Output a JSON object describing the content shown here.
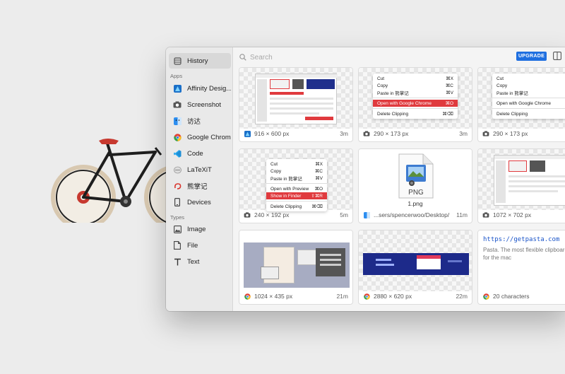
{
  "sidebar": {
    "history": "History",
    "apps_heading": "Apps",
    "apps": [
      {
        "label": "Affinity Desig...",
        "icon": "affinity-designer-icon"
      },
      {
        "label": "Screenshot",
        "icon": "camera-icon"
      },
      {
        "label": "访达",
        "icon": "finder-icon"
      },
      {
        "label": "Google Chrome",
        "icon": "chrome-icon"
      },
      {
        "label": "Code",
        "icon": "vscode-icon"
      },
      {
        "label": "LaTeXiT",
        "icon": "latexit-icon"
      },
      {
        "label": "熊掌记",
        "icon": "bear-icon"
      },
      {
        "label": "Devices",
        "icon": "device-icon"
      }
    ],
    "types_heading": "Types",
    "types": [
      {
        "label": "Image",
        "icon": "image-icon"
      },
      {
        "label": "File",
        "icon": "file-icon"
      },
      {
        "label": "Text",
        "icon": "text-icon"
      }
    ]
  },
  "toolbar": {
    "search_placeholder": "Search",
    "upgrade_label": "UPGRADE"
  },
  "menu_a": {
    "items": [
      {
        "label": "Cut",
        "shortcut": "⌘X"
      },
      {
        "label": "Copy",
        "shortcut": "⌘C"
      },
      {
        "label": "Paste in 熊掌记",
        "shortcut": "⌘V"
      },
      {
        "label": "Open with Google Chrome",
        "shortcut": "⌘O"
      },
      {
        "label": "Delete Clipping",
        "shortcut": "⌘⌫"
      }
    ]
  },
  "menu_b": {
    "items": [
      {
        "label": "Cut",
        "shortcut": "⌘X"
      },
      {
        "label": "Copy",
        "shortcut": "⌘C"
      },
      {
        "label": "Paste in 熊掌记",
        "shortcut": ""
      },
      {
        "label": "Open with Google Chrome",
        "shortcut": ""
      },
      {
        "label": "Delete Clipping",
        "shortcut": ""
      }
    ]
  },
  "menu_c": {
    "items": [
      {
        "label": "Cut",
        "shortcut": "⌘X"
      },
      {
        "label": "Copy",
        "shortcut": "⌘C"
      },
      {
        "label": "Paste in 熊掌记",
        "shortcut": "⌘V"
      },
      {
        "label": "Open with Preview",
        "shortcut": "⌘O"
      },
      {
        "label": "Show in Finder",
        "shortcut": "⇧⌘R"
      },
      {
        "label": "Delete Clipping",
        "shortcut": "⌘⌫"
      }
    ]
  },
  "clips": [
    {
      "desc": "916 × 600 px",
      "time": "3m",
      "source_icon": "affinity-designer-icon"
    },
    {
      "desc": "290 × 173 px",
      "time": "3m",
      "source_icon": "camera-icon"
    },
    {
      "desc": "290 × 173 px",
      "time": "",
      "source_icon": "camera-icon"
    },
    {
      "desc": "240 × 192 px",
      "time": "5m",
      "source_icon": "camera-icon"
    },
    {
      "desc": "...sers/spencerwoo/Desktop/",
      "time": "11m",
      "source_icon": "finder-icon",
      "file_label": "1.png",
      "file_type": "PNG"
    },
    {
      "desc": "1072 × 702 px",
      "time": "",
      "source_icon": "camera-icon"
    },
    {
      "desc": "1024 × 435 px",
      "time": "21m",
      "source_icon": "chrome-icon"
    },
    {
      "desc": "2880 × 620 px",
      "time": "22m",
      "source_icon": "chrome-icon"
    },
    {
      "desc": "20 characters",
      "time": "",
      "source_icon": "chrome-icon",
      "link": "https://getpasta.com",
      "text": "Pasta. The most flexible clipboard manager for the mac"
    }
  ],
  "colors": {
    "accent": "#1f6fe0",
    "highlight": "#e03a3e",
    "link": "#1b55c9"
  }
}
